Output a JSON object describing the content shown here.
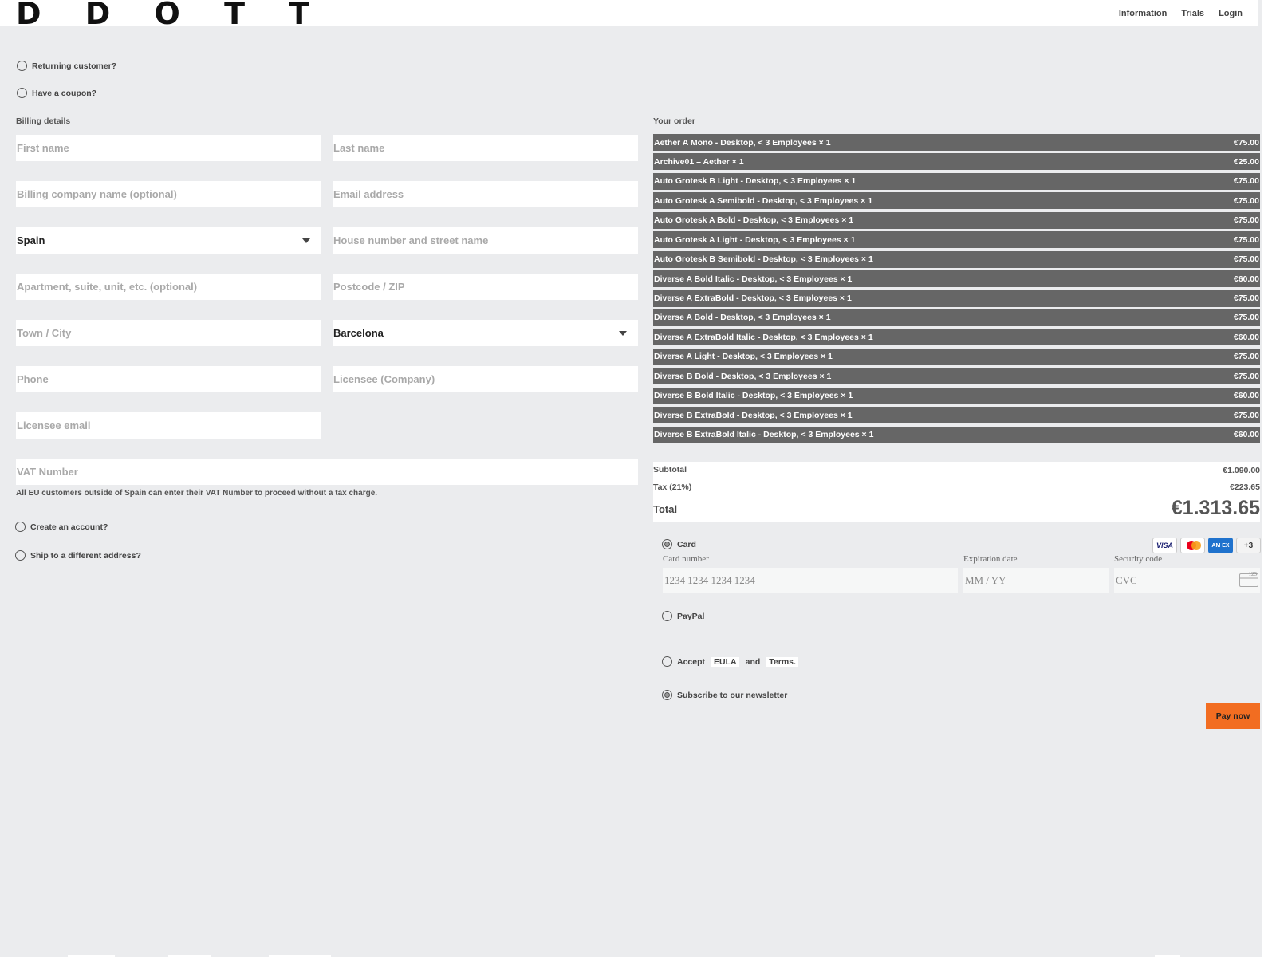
{
  "header": {
    "logo": "D D O T T",
    "nav": [
      "Information",
      "Trials",
      "Login"
    ]
  },
  "checkout_options": {
    "returning": "Returning customer?",
    "coupon": "Have a coupon?"
  },
  "billing": {
    "title": "Billing details",
    "first_name": "First name",
    "last_name": "Last name",
    "company": "Billing company name (optional)",
    "email": "Email address",
    "country": "Spain",
    "street": "House number and street name",
    "apartment": "Apartment, suite, unit, etc. (optional)",
    "postcode": "Postcode / ZIP",
    "town": "Town / City",
    "province": "Barcelona",
    "phone": "Phone",
    "licensee_company": "Licensee (Company)",
    "licensee_email": "Licensee email",
    "vat": "VAT Number",
    "vat_note": "All EU customers outside of Spain can enter their VAT Number to proceed without a tax charge.",
    "create_account": "Create an account?",
    "ship_different": "Ship to a different address?"
  },
  "order": {
    "title": "Your order",
    "items": [
      {
        "name": "Aether A Mono - Desktop, < 3 Employees  × 1",
        "price": "€75.00"
      },
      {
        "name": "Archive01 – Aether  × 1",
        "price": "€25.00"
      },
      {
        "name": "Auto Grotesk B Light - Desktop, < 3 Employees  × 1",
        "price": "€75.00"
      },
      {
        "name": "Auto Grotesk A Semibold - Desktop, < 3 Employees  × 1",
        "price": "€75.00"
      },
      {
        "name": "Auto Grotesk A Bold - Desktop, < 3 Employees  × 1",
        "price": "€75.00"
      },
      {
        "name": "Auto Grotesk A Light - Desktop, < 3 Employees  × 1",
        "price": "€75.00"
      },
      {
        "name": "Auto Grotesk B Semibold - Desktop, < 3 Employees  × 1",
        "price": "€75.00"
      },
      {
        "name": "Diverse A Bold Italic - Desktop, < 3 Employees  × 1",
        "price": "€60.00"
      },
      {
        "name": "Diverse A ExtraBold - Desktop, < 3 Employees  × 1",
        "price": "€75.00"
      },
      {
        "name": "Diverse A Bold - Desktop, < 3 Employees  × 1",
        "price": "€75.00"
      },
      {
        "name": "Diverse A ExtraBold Italic - Desktop, < 3 Employees  × 1",
        "price": "€60.00"
      },
      {
        "name": "Diverse A Light - Desktop, < 3 Employees  × 1",
        "price": "€75.00"
      },
      {
        "name": "Diverse B Bold - Desktop, < 3 Employees  × 1",
        "price": "€75.00"
      },
      {
        "name": "Diverse B Bold Italic - Desktop, < 3 Employees  × 1",
        "price": "€60.00"
      },
      {
        "name": "Diverse B ExtraBold - Desktop, < 3 Employees  × 1",
        "price": "€75.00"
      },
      {
        "name": "Diverse B ExtraBold Italic - Desktop, < 3 Employees  × 1",
        "price": "€60.00"
      }
    ],
    "subtotal_label": "Subtotal",
    "subtotal": "€1.090.00",
    "tax_label": "Tax (21%)",
    "tax": "€223.65",
    "total_label": "Total",
    "total": "€1.313.65"
  },
  "payment": {
    "card_label": "Card",
    "card_number_label": "Card number",
    "card_number_placeholder": "1234 1234 1234 1234",
    "expiry_label": "Expiration date",
    "expiry_placeholder": "MM / YY",
    "cvc_label": "Security code",
    "cvc_placeholder": "CVC",
    "cvc_icon_text": "123",
    "visa": "VISA",
    "amex": "AM EX",
    "more_cards": "+3",
    "paypal_label": "PayPal",
    "accept_prefix": "Accept",
    "eula": "EULA",
    "and": "and",
    "terms": "Terms.",
    "newsletter": "Subscribe to our newsletter",
    "pay_now": "Pay now"
  },
  "colors": {
    "background": "#ebecee",
    "order_row": "#666666",
    "pay_button": "#f26d21"
  }
}
